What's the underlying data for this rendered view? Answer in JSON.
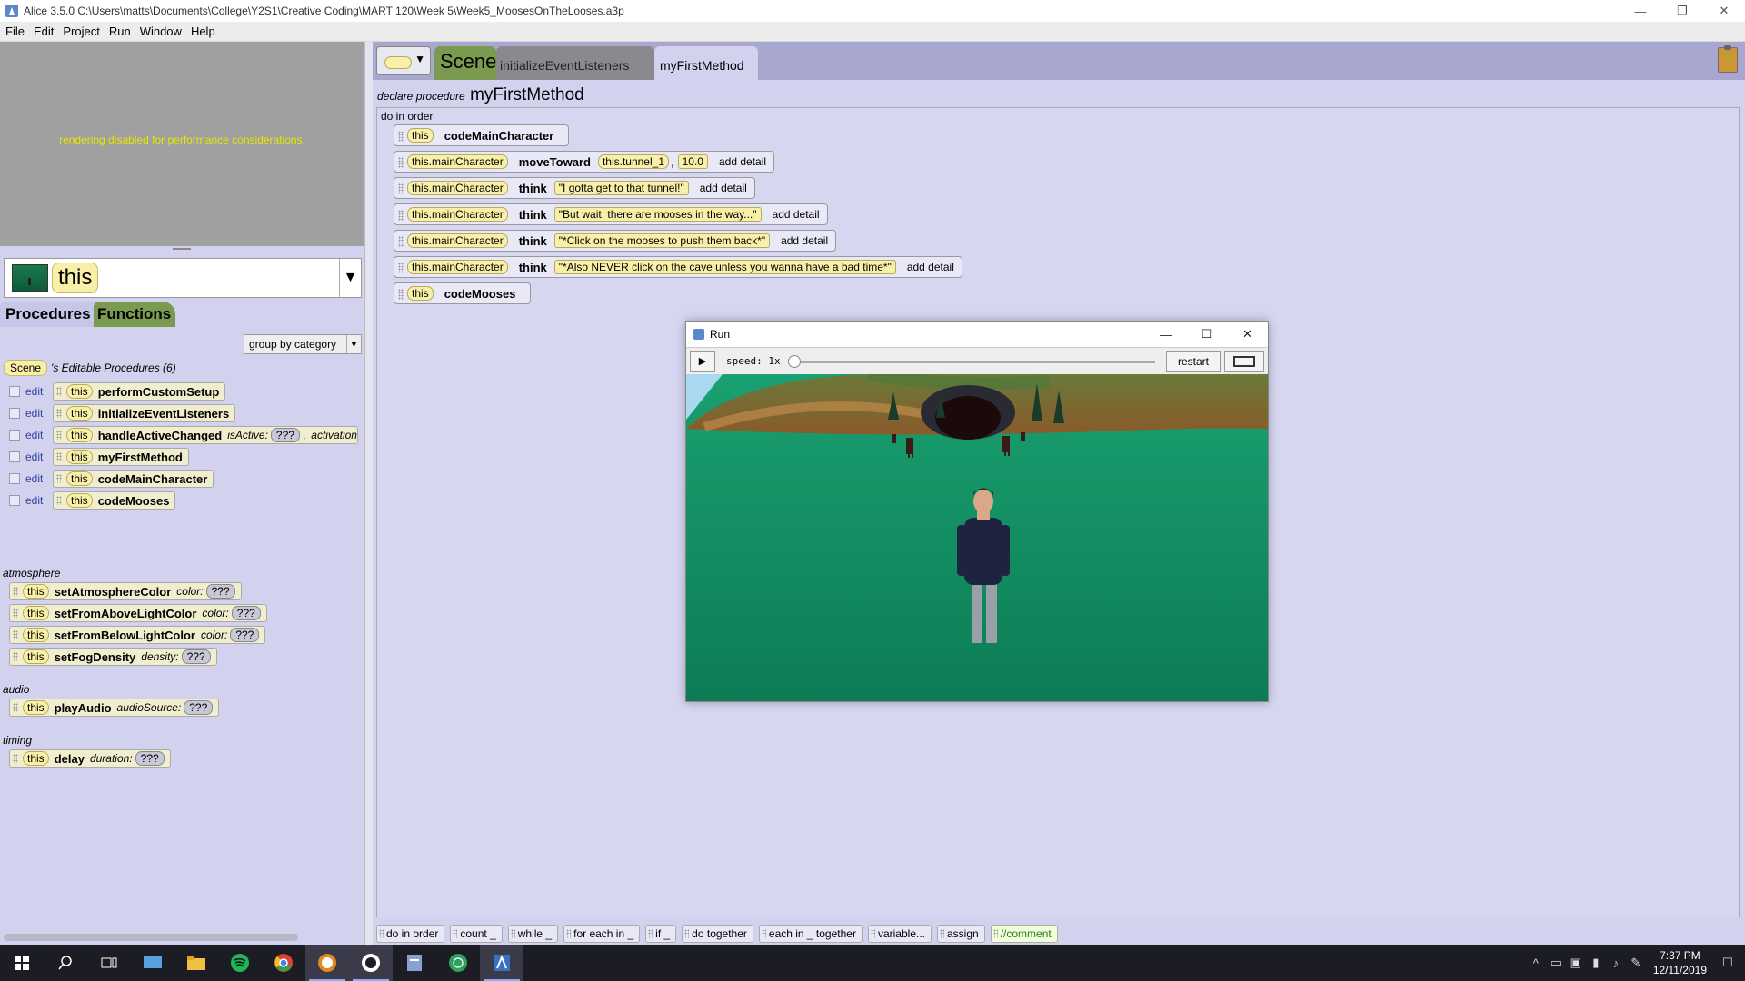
{
  "window": {
    "title": "Alice 3.5.0 C:\\Users\\matts\\Documents\\College\\Y2S1\\Creative Coding\\MART 120\\Week 5\\Week5_MoosesOnTheLooses.a3p",
    "minimize": "—",
    "restore": "❐",
    "close": "✕"
  },
  "menu": [
    "File",
    "Edit",
    "Project",
    "Run",
    "Window",
    "Help"
  ],
  "preview": {
    "message": "rendering disabled for performance considerations."
  },
  "selector": {
    "value": "this"
  },
  "left_tabs": {
    "procedures": "Procedures",
    "functions": "Functions"
  },
  "group_by": "group by category",
  "editable": {
    "scene_label": "Scene",
    "heading": "'s Editable Procedures (6)",
    "edit_label": "edit",
    "this_label": "this",
    "items": [
      {
        "name": "performCustomSetup"
      },
      {
        "name": "initializeEventListeners"
      },
      {
        "name": "handleActiveChanged",
        "param1": "isActive:",
        "q1": "???",
        "sep": ",",
        "param2": "activation"
      },
      {
        "name": "myFirstMethod"
      },
      {
        "name": "codeMainCharacter"
      },
      {
        "name": "codeMooses"
      }
    ]
  },
  "categories": [
    {
      "name": "atmosphere",
      "items": [
        {
          "name": "setAtmosphereColor",
          "param": "color:",
          "q": "???"
        },
        {
          "name": "setFromAboveLightColor",
          "param": "color:",
          "q": "???"
        },
        {
          "name": "setFromBelowLightColor",
          "param": "color:",
          "q": "???"
        },
        {
          "name": "setFogDensity",
          "param": "density:",
          "q": "???"
        }
      ]
    },
    {
      "name": "audio",
      "items": [
        {
          "name": "playAudio",
          "param": "audioSource:",
          "q": "???"
        }
      ]
    },
    {
      "name": "timing",
      "items": [
        {
          "name": "delay",
          "param": "duration:",
          "q": "???"
        }
      ]
    }
  ],
  "editor_tabs": {
    "scene": "Scene",
    "init": "initializeEventListeners",
    "current": "myFirstMethod"
  },
  "declare": {
    "prefix": "declare procedure",
    "name": "myFirstMethod"
  },
  "do_in_order": "do in order",
  "statements": [
    {
      "obj": "this",
      "method": "codeMainCharacter"
    },
    {
      "obj": "this.mainCharacter",
      "method": "moveToward",
      "arg": "this.tunnel_1",
      "sep": ",",
      "num": "10.0",
      "detail": "add detail"
    },
    {
      "obj": "this.mainCharacter",
      "method": "think",
      "arg": "\"I gotta get to that tunnel!\"",
      "detail": "add detail"
    },
    {
      "obj": "this.mainCharacter",
      "method": "think",
      "arg": "\"But wait, there are mooses in the way...\"",
      "detail": "add detail"
    },
    {
      "obj": "this.mainCharacter",
      "method": "think",
      "arg": "\"*Click on the mooses to push them back*\"",
      "detail": "add detail"
    },
    {
      "obj": "this.mainCharacter",
      "method": "think",
      "arg": "\"*Also NEVER click on the cave unless you wanna have a bad time*\"",
      "detail": "add detail"
    },
    {
      "obj": "this",
      "method": "codeMooses"
    }
  ],
  "run_window": {
    "title": "Run",
    "minimize": "—",
    "maximize": "☐",
    "close": "✕",
    "play": "▶",
    "speed_label": "speed: 1x",
    "speed_fraction": 0,
    "restart": "restart"
  },
  "palette": [
    "do in order",
    "count _",
    "while _",
    "for each in _",
    "if _",
    "do together",
    "each in _ together",
    "variable...",
    "assign",
    "//comment"
  ],
  "taskbar": {
    "time": "7:37 PM",
    "date": "12/11/2019"
  },
  "colors": {
    "panel": "#d2d2ee",
    "editor_bg": "#a7a7cf",
    "scene_tab": "#7a9a50",
    "pill": "#f8f0a8",
    "ground": "#119063"
  }
}
